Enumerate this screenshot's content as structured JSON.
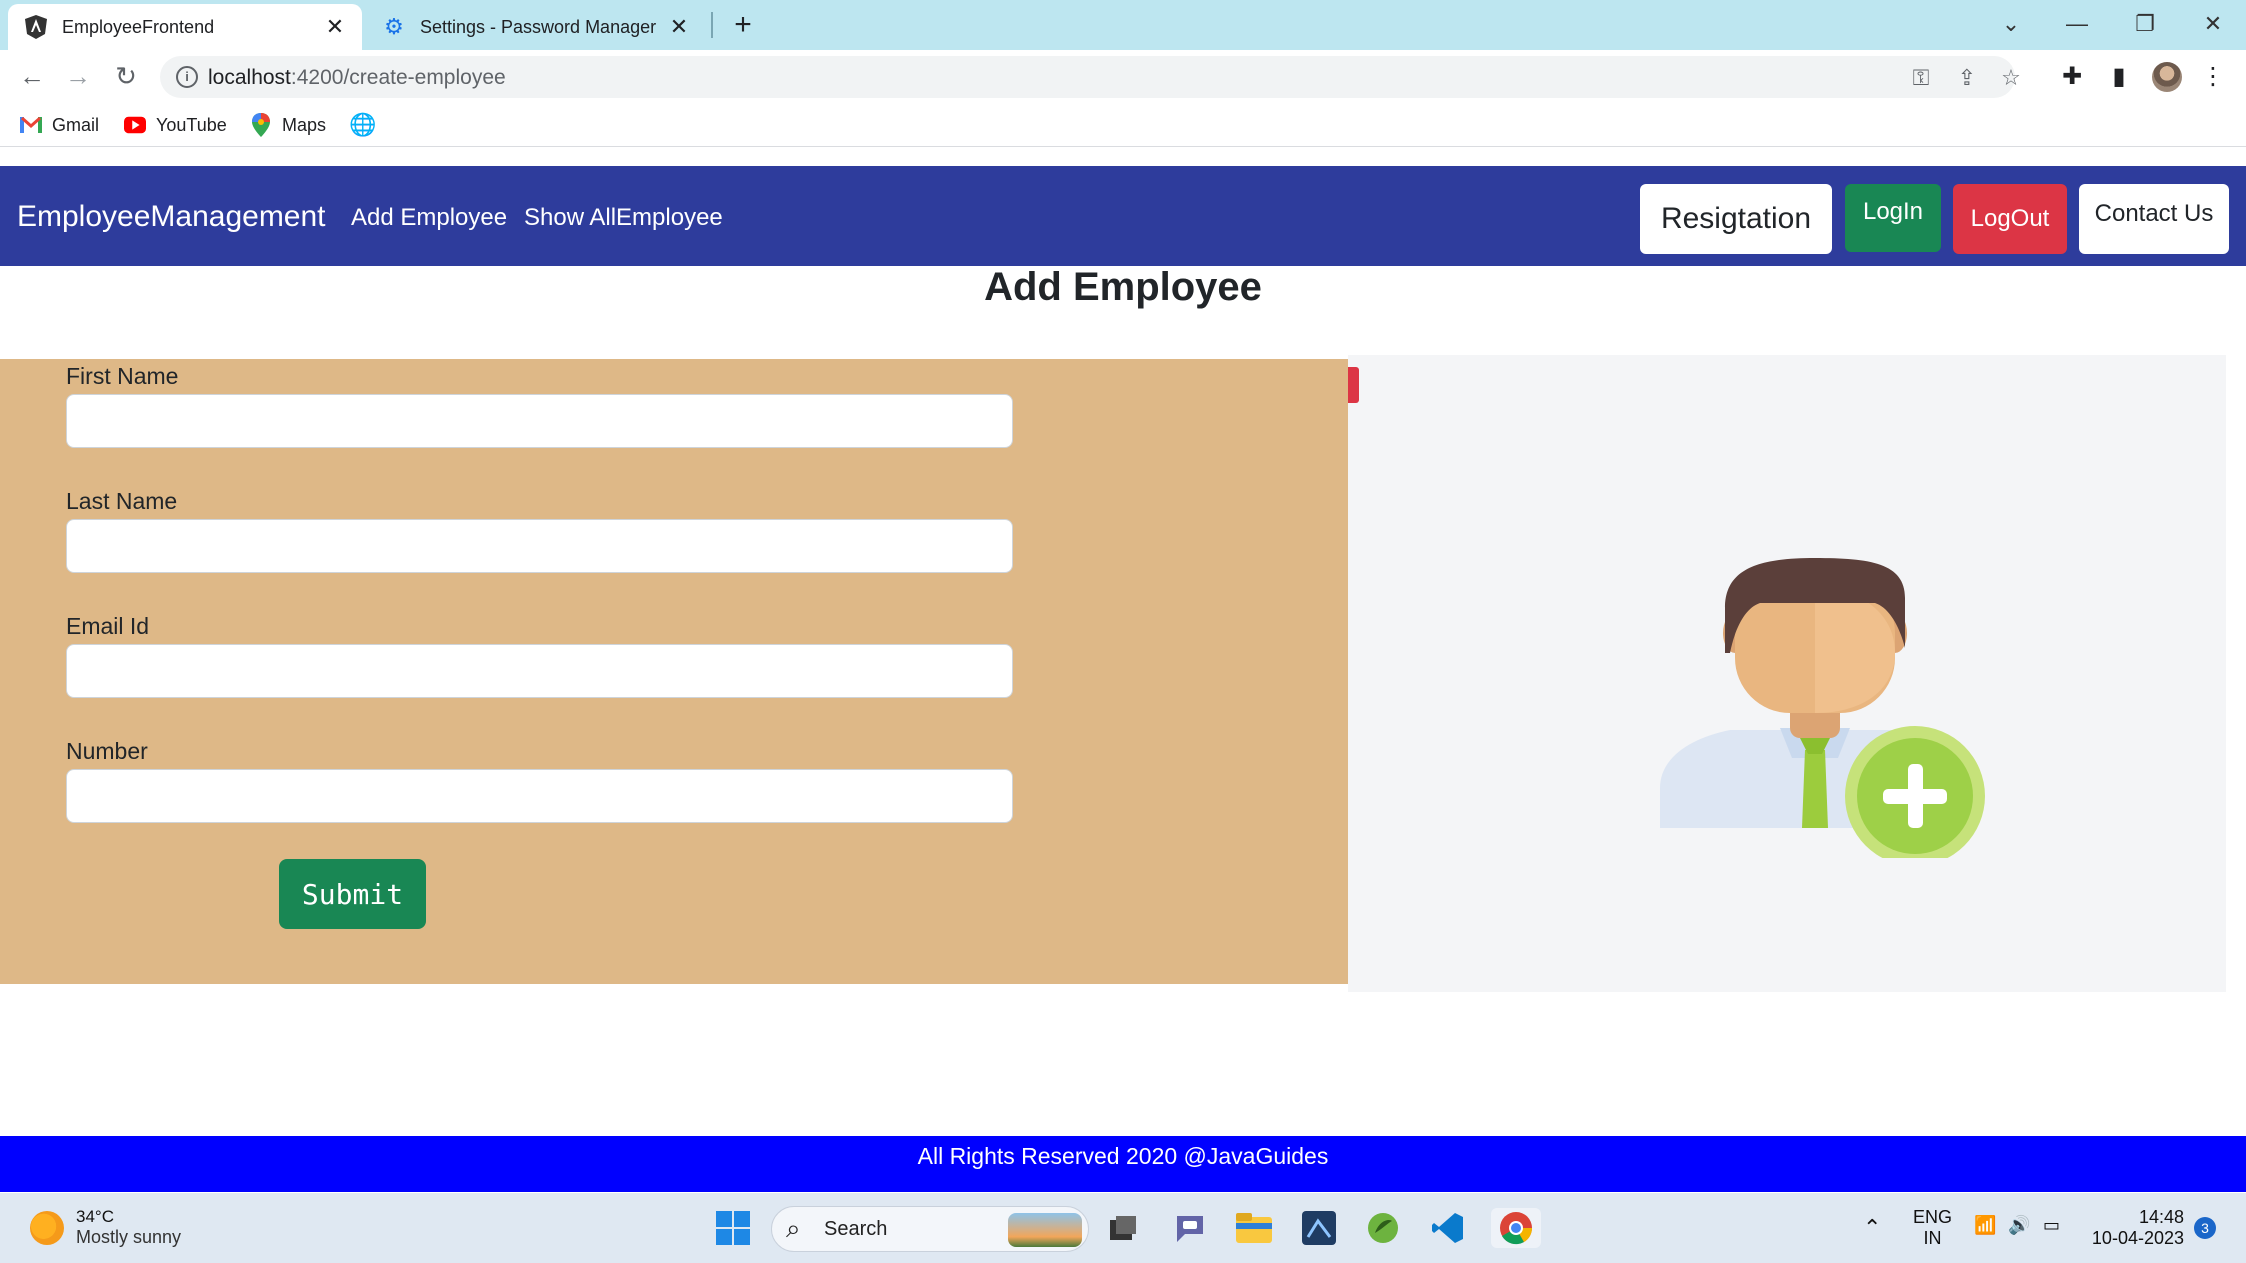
{
  "browser": {
    "tabs": [
      {
        "title": "EmployeeFrontend",
        "active": true
      },
      {
        "title": "Settings - Password Manager",
        "active": false
      }
    ],
    "url_host": "localhost",
    "url_path": ":4200/create-employee",
    "bookmarks": [
      {
        "label": "Gmail",
        "icon": "gmail-icon"
      },
      {
        "label": "YouTube",
        "icon": "youtube-icon"
      },
      {
        "label": "Maps",
        "icon": "maps-icon"
      }
    ]
  },
  "navbar": {
    "brand": "EmployeeManagement",
    "links": [
      "Add Employee",
      "Show AllEmployee"
    ],
    "buttons": {
      "registration": "Resigtation",
      "login": "LogIn",
      "logout": "LogOut",
      "contact": "Contact Us"
    }
  },
  "form": {
    "heading": "Add Employee",
    "fields": [
      {
        "label": "First Name",
        "value": ""
      },
      {
        "label": "Last Name",
        "value": ""
      },
      {
        "label": "Email Id",
        "value": ""
      },
      {
        "label": "Number",
        "value": ""
      }
    ],
    "submit_label": "Submit"
  },
  "footer": {
    "text": "All Rights Reserved 2020 @JavaGuides"
  },
  "taskbar": {
    "weather_temp": "34°C",
    "weather_desc": "Mostly sunny",
    "search_label": "Search",
    "lang_line1": "ENG",
    "lang_line2": "IN",
    "time": "14:48",
    "date": "10-04-2023",
    "notification_count": "3"
  },
  "colors": {
    "navbar": "#2e3c9c",
    "form_panel": "#deb887",
    "footer": "#0000ff",
    "success": "#198754",
    "danger": "#dc3545"
  }
}
